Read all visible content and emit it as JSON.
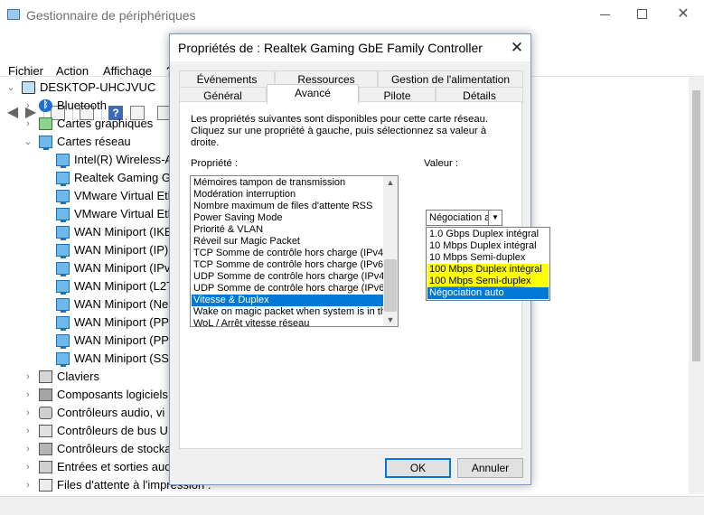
{
  "device_manager": {
    "title": "Gestionnaire de périphériques",
    "menu": [
      "Fichier",
      "Action",
      "Affichage",
      "?"
    ],
    "tree": [
      {
        "label": "DESKTOP-UHCJVUC",
        "level": 0,
        "expanded": true,
        "icon": "computer-icon"
      },
      {
        "label": "Bluetooth",
        "level": 1,
        "expanded": false,
        "icon": "bluetooth-icon"
      },
      {
        "label": "Cartes graphiques",
        "level": 1,
        "expanded": false,
        "icon": "display-adapter-icon"
      },
      {
        "label": "Cartes réseau",
        "level": 1,
        "expanded": true,
        "icon": "network-adapter-icon"
      },
      {
        "label": "Intel(R) Wireless-A",
        "level": 2,
        "icon": "network-adapter-icon"
      },
      {
        "label": "Realtek Gaming Gb",
        "level": 2,
        "icon": "network-adapter-icon"
      },
      {
        "label": "VMware Virtual Eth",
        "level": 2,
        "icon": "network-adapter-icon"
      },
      {
        "label": "VMware Virtual Eth",
        "level": 2,
        "icon": "network-adapter-icon"
      },
      {
        "label": "WAN Miniport (IKE",
        "level": 2,
        "icon": "network-adapter-icon"
      },
      {
        "label": "WAN Miniport (IP)",
        "level": 2,
        "icon": "network-adapter-icon"
      },
      {
        "label": "WAN Miniport (IPv",
        "level": 2,
        "icon": "network-adapter-icon"
      },
      {
        "label": "WAN Miniport (L2T",
        "level": 2,
        "icon": "network-adapter-icon"
      },
      {
        "label": "WAN Miniport (Ne",
        "level": 2,
        "icon": "network-adapter-icon"
      },
      {
        "label": "WAN Miniport (PP",
        "level": 2,
        "icon": "network-adapter-icon"
      },
      {
        "label": "WAN Miniport (PP",
        "level": 2,
        "icon": "network-adapter-icon"
      },
      {
        "label": "WAN Miniport (SS",
        "level": 2,
        "icon": "network-adapter-icon"
      },
      {
        "label": "Claviers",
        "level": 1,
        "expanded": false,
        "icon": "keyboard-icon"
      },
      {
        "label": "Composants logiciels",
        "level": 1,
        "expanded": false,
        "icon": "software-component-icon"
      },
      {
        "label": "Contrôleurs audio, vi",
        "level": 1,
        "expanded": false,
        "icon": "audio-icon"
      },
      {
        "label": "Contrôleurs de bus U",
        "level": 1,
        "expanded": false,
        "icon": "usb-icon"
      },
      {
        "label": "Contrôleurs de stocka",
        "level": 1,
        "expanded": false,
        "icon": "storage-icon"
      },
      {
        "label": "Entrées et sorties aud",
        "level": 1,
        "expanded": false,
        "icon": "audio-io-icon"
      },
      {
        "label": "Files d'attente à l'impression :",
        "level": 1,
        "expanded": false,
        "icon": "printer-icon"
      }
    ]
  },
  "dialog": {
    "title": "Propriétés de : Realtek Gaming GbE Family Controller",
    "tabs_row1": [
      "Événements",
      "Ressources",
      "Gestion de l'alimentation"
    ],
    "tabs_row2": [
      "Général",
      "Avancé",
      "Pilote",
      "Détails"
    ],
    "active_tab": "Avancé",
    "description": "Les propriétés suivantes sont disponibles pour cette carte réseau. Cliquez sur une propriété à gauche, puis sélectionnez sa valeur à droite.",
    "property_label": "Propriété :",
    "value_label": "Valeur :",
    "properties": [
      "Mémoires tampon de transmission",
      "Modération interruption",
      "Nombre maximum de files d'attente RSS",
      "Power Saving Mode",
      "Priorité & VLAN",
      "Réveil sur Magic Packet",
      "TCP Somme de contrôle hors charge (IPv4)",
      "TCP Somme de contrôle hors charge (IPv6)",
      "UDP Somme de contrôle hors charge (IPv4)",
      "UDP Somme de contrôle hors charge (IPv6)",
      "Vitesse & Duplex",
      "Wake on magic packet when system is in th",
      "WoL / Arrêt vitesse réseau"
    ],
    "selected_property": "Vitesse & Duplex",
    "value_current": "Négociation a",
    "value_options": [
      "1.0 Gbps Duplex intégral",
      "10 Mbps Duplex intégral",
      "10 Mbps Semi-duplex",
      "100 Mbps Duplex intégral",
      "100 Mbps Semi-duplex",
      "Négociation auto"
    ],
    "highlighted_options": [
      "100 Mbps Duplex intégral",
      "100 Mbps Semi-duplex"
    ],
    "selected_option": "Négociation auto",
    "ok_label": "OK",
    "cancel_label": "Annuler"
  },
  "colors": {
    "selection": "#0078d7",
    "highlight": "#ffff00",
    "underline_mark": "#8ab82b"
  }
}
